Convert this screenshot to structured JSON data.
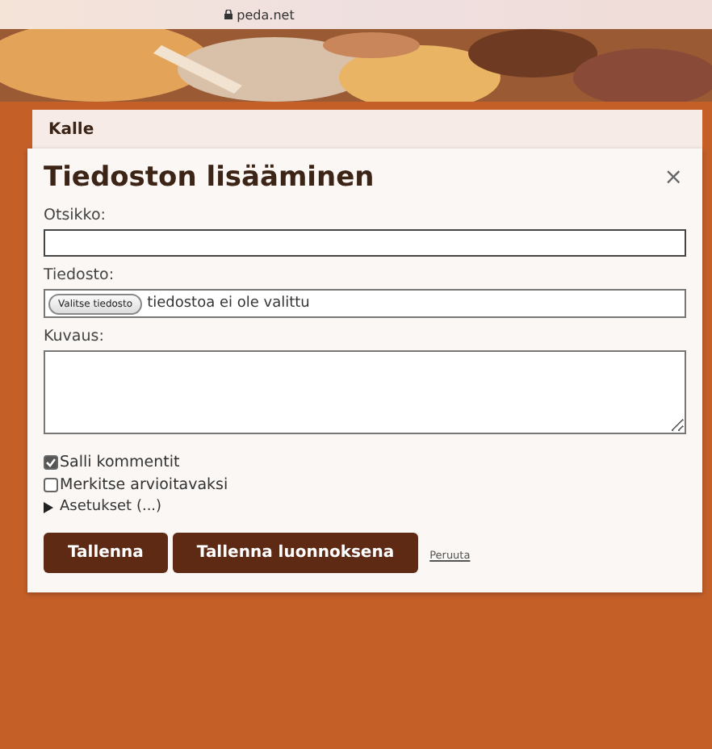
{
  "browser": {
    "address": "peda.net"
  },
  "page": {
    "title": "Kalle"
  },
  "dialog": {
    "title": "Tiedoston lisääminen",
    "close": "×",
    "fields": [
      {
        "kind": "text",
        "label": "Otsikko:"
      },
      {
        "kind": "file",
        "label": "Tiedosto:",
        "button": "Valitse tiedosto",
        "status": "tiedostoa ei ole valittu"
      },
      {
        "kind": "textarea",
        "label": "Kuvaus:"
      }
    ],
    "checkboxes": [
      {
        "label": "Salli kommentit",
        "checked": true
      },
      {
        "label": "Merkitse arvioitavaksi",
        "checked": false
      }
    ],
    "disclosure": {
      "label": "Asetukset (...)",
      "expanded": false
    },
    "buttons": [
      "Tallenna",
      "Tallenna luonnoksena"
    ],
    "cancel": "Peruuta"
  }
}
